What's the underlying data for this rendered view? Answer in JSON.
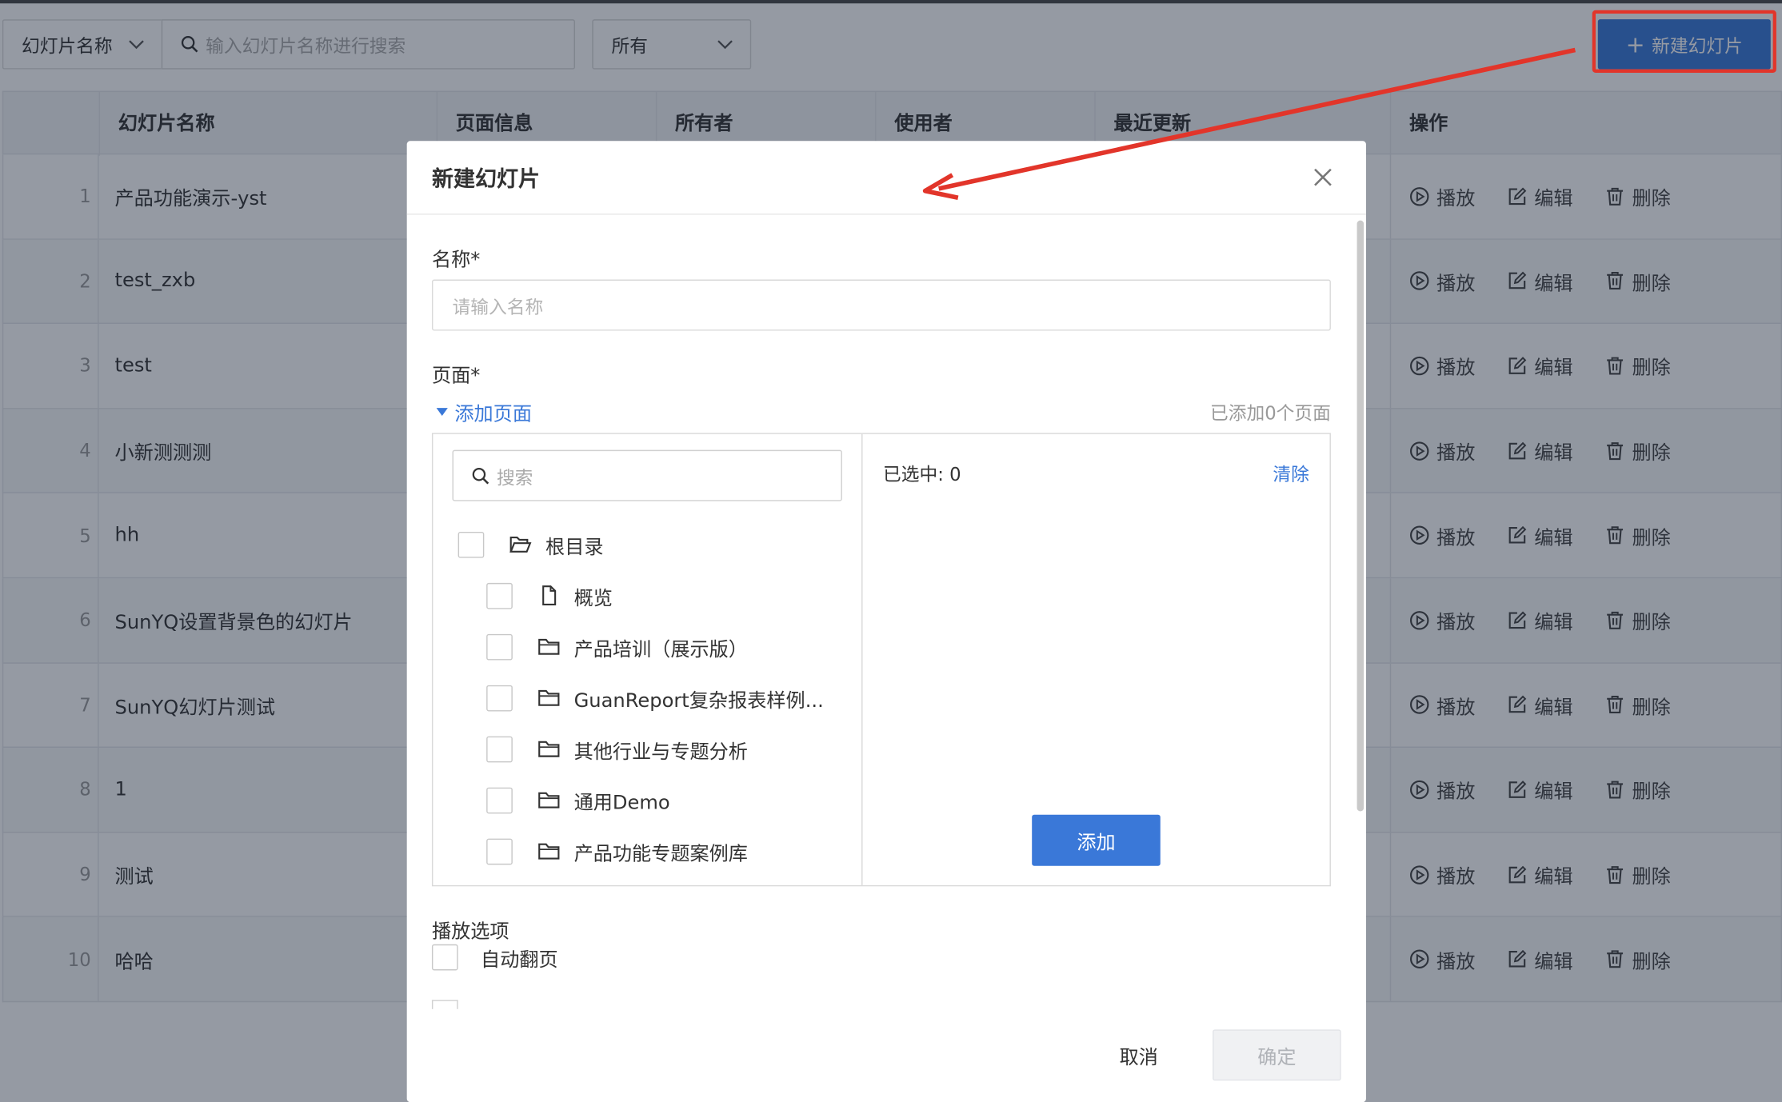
{
  "toolbar": {
    "type_select": "幻灯片名称",
    "search_placeholder": "输入幻灯片名称进行搜索",
    "owner_select": "所有",
    "new_button": "新建幻灯片"
  },
  "table": {
    "columns": [
      "幻灯片名称",
      "页面信息",
      "所有者",
      "使用者",
      "最近更新",
      "操作"
    ],
    "rows": [
      {
        "index": "1",
        "name": "产品功能演示-yst"
      },
      {
        "index": "2",
        "name": "test_zxb"
      },
      {
        "index": "3",
        "name": "test"
      },
      {
        "index": "4",
        "name": "小新测测测"
      },
      {
        "index": "5",
        "name": "hh"
      },
      {
        "index": "6",
        "name": "SunYQ设置背景色的幻灯片"
      },
      {
        "index": "7",
        "name": "SunYQ幻灯片测试"
      },
      {
        "index": "8",
        "name": "1"
      },
      {
        "index": "9",
        "name": "测试"
      },
      {
        "index": "10",
        "name": "哈哈"
      }
    ],
    "actions": {
      "play": "播放",
      "edit": "编辑",
      "delete": "删除"
    }
  },
  "modal": {
    "title": "新建幻灯片",
    "name_label": "名称*",
    "name_placeholder": "请输入名称",
    "pages_label": "页面*",
    "add_pages_toggle": "添加页面",
    "added_count": "已添加0个页面",
    "search_placeholder": "搜索",
    "tree": {
      "root": "根目录",
      "items": [
        "概览",
        "产品培训（展示版）",
        "GuanReport复杂报表样例...",
        "其他行业与专题分析",
        "通用Demo",
        "产品功能专题案例库"
      ]
    },
    "selected_count": "已选中: 0",
    "clear": "清除",
    "add_button": "添加",
    "play_options_label": "播放选项",
    "auto_flip": "自动翻页",
    "cancel": "取消",
    "confirm": "确定"
  },
  "colors": {
    "accent": "#3a78d8",
    "annotation": "#e2352a"
  }
}
